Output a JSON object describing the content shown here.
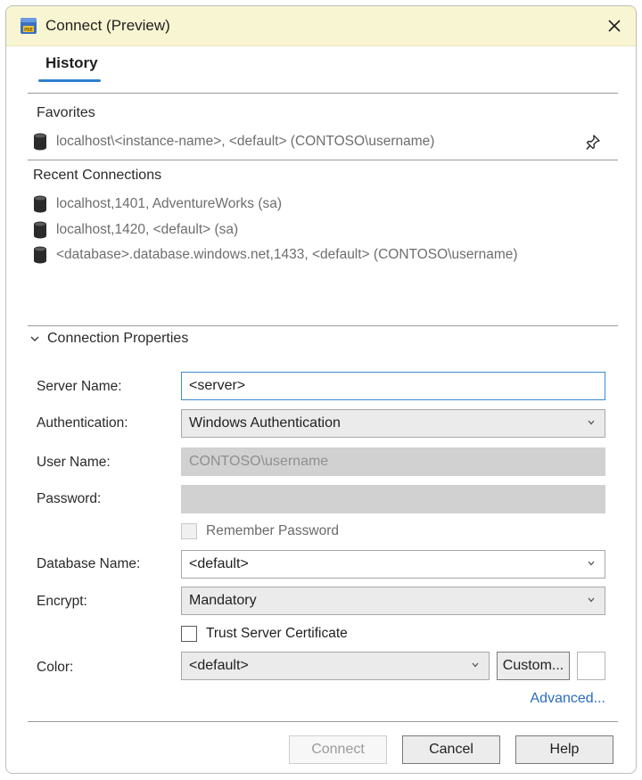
{
  "window": {
    "title": "Connect (Preview)",
    "close_glyph": "✕"
  },
  "tabs": [
    {
      "label": "History",
      "selected": true
    }
  ],
  "favorites": {
    "label": "Favorites",
    "items": [
      {
        "text": "localhost\\<instance-name>, <default> (CONTOSO\\username)",
        "pinned": true
      }
    ]
  },
  "recent": {
    "label": "Recent Connections",
    "items": [
      {
        "text": "localhost,1401, AdventureWorks (sa)"
      },
      {
        "text": "localhost,1420, <default> (sa)"
      },
      {
        "text": "<database>.database.windows.net,1433, <default> (CONTOSO\\username)"
      }
    ]
  },
  "properties": {
    "header": "Connection Properties",
    "server_name": {
      "label": "Server Name:",
      "value": "<server>"
    },
    "authentication": {
      "label": "Authentication:",
      "value": "Windows Authentication"
    },
    "user_name": {
      "label": "User Name:",
      "value": "CONTOSO\\username"
    },
    "password": {
      "label": "Password:",
      "value": ""
    },
    "remember_password": {
      "label": "Remember Password",
      "checked": false
    },
    "database_name": {
      "label": "Database Name:",
      "value": "<default>"
    },
    "encrypt": {
      "label": "Encrypt:",
      "value": "Mandatory"
    },
    "trust_cert": {
      "label": "Trust Server Certificate",
      "checked": false
    },
    "color": {
      "label": "Color:",
      "value": "<default>",
      "custom_label": "Custom...",
      "swatch": "#ffffff"
    },
    "advanced_link": "Advanced..."
  },
  "buttons": {
    "connect": "Connect",
    "cancel": "Cancel",
    "help": "Help"
  },
  "colors": {
    "accent": "#2f7fd0",
    "titlebar": "#f8f5d2",
    "link": "#2a6cc2"
  },
  "icons": {
    "app": "sql-app-icon",
    "db": "database-icon",
    "pin": "pin-icon",
    "chevron": "chevron-down-icon"
  }
}
